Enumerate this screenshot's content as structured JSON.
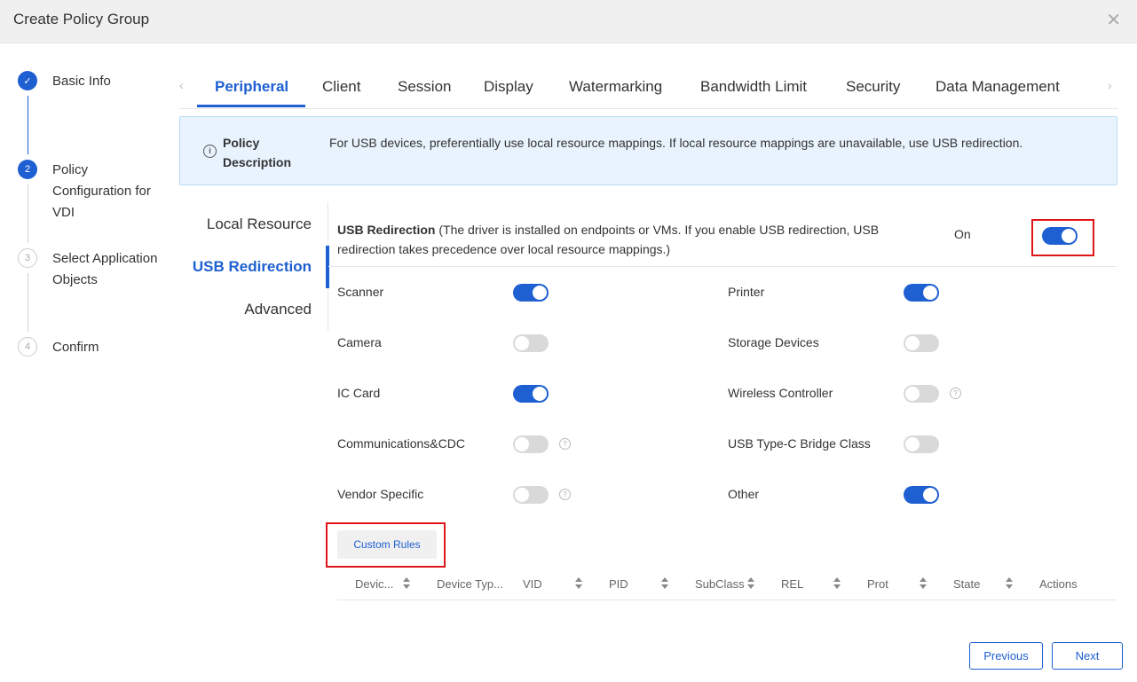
{
  "dialog": {
    "title": "Create Policy Group",
    "close_icon": "✕"
  },
  "steps": [
    {
      "index": "✓",
      "label": "Basic Info",
      "state": "done"
    },
    {
      "index": "2",
      "label": "Policy Configuration for VDI",
      "state": "active"
    },
    {
      "index": "3",
      "label": "Select Application Objects",
      "state": "pending"
    },
    {
      "index": "4",
      "label": "Confirm",
      "state": "pending"
    }
  ],
  "tabs": {
    "prev_arrow": "‹",
    "next_arrow": "›",
    "items": [
      "Peripheral",
      "Client",
      "Session",
      "Display",
      "Watermarking",
      "Bandwidth Limit",
      "Security",
      "Data Management"
    ],
    "active": "Peripheral"
  },
  "policy_description": {
    "label": "Policy Description",
    "icon": "i",
    "text": "For USB devices, preferentially use local resource mappings. If local resource mappings are unavailable, use USB redirection."
  },
  "subnav": {
    "items": [
      "Local Resource",
      "USB Redirection",
      "Advanced"
    ],
    "active": "USB Redirection"
  },
  "usb_redirection": {
    "title": "USB Redirection",
    "note": " (The driver is installed on endpoints or VMs. If you enable USB redirection, USB redirection takes precedence over local resource mappings.)",
    "status_label": "On",
    "enabled": true
  },
  "devices": [
    {
      "label": "Scanner",
      "on": true,
      "help": false
    },
    {
      "label": "Printer",
      "on": true,
      "help": false
    },
    {
      "label": "Camera",
      "on": false,
      "help": false
    },
    {
      "label": "Storage Devices",
      "on": false,
      "help": false
    },
    {
      "label": "IC Card",
      "on": true,
      "help": false
    },
    {
      "label": "Wireless Controller",
      "on": false,
      "help": true
    },
    {
      "label": "Communications&CDC",
      "on": false,
      "help": true
    },
    {
      "label": "USB Type-C Bridge Class",
      "on": false,
      "help": false
    },
    {
      "label": "Vendor Specific",
      "on": false,
      "help": true
    },
    {
      "label": "Other",
      "on": true,
      "help": false
    }
  ],
  "custom_rules": {
    "label": "Custom Rules"
  },
  "table": {
    "columns": [
      "Devic...",
      "Device Typ...",
      "VID",
      "PID",
      "SubClass",
      "REL",
      "Prot",
      "State",
      "Actions"
    ]
  },
  "footer": {
    "previous_label": "Previous",
    "next_label": "Next"
  },
  "colors": {
    "accent": "#1e5fd1",
    "highlight": "#e0161b",
    "info_bg": "#e8f3fd"
  }
}
